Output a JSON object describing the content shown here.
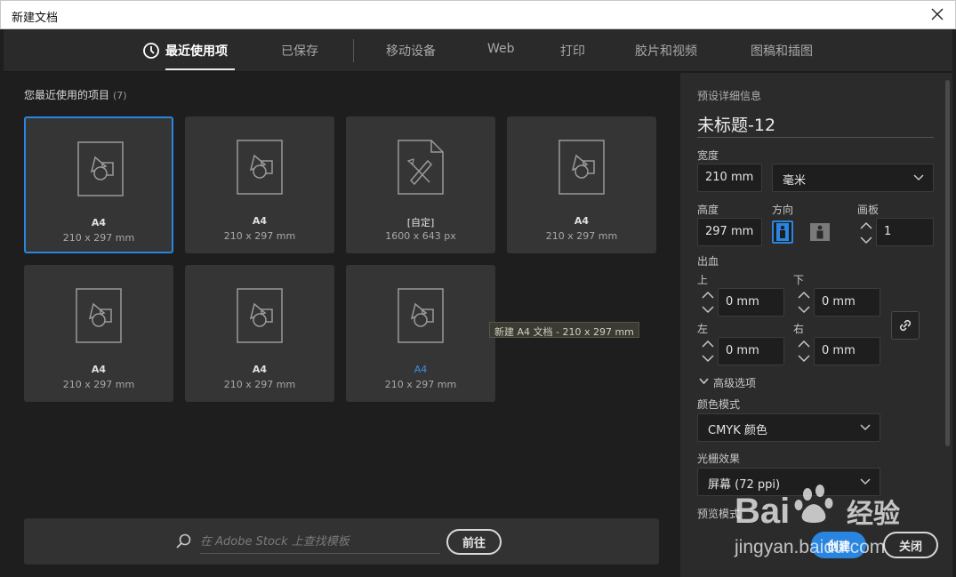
{
  "window": {
    "title": "新建文档"
  },
  "tabs": [
    {
      "label": "最近使用项",
      "active": true
    },
    {
      "label": "已保存"
    },
    {
      "label": "移动设备"
    },
    {
      "label": "Web"
    },
    {
      "label": "打印"
    },
    {
      "label": "胶片和视频"
    },
    {
      "label": "图稿和插图"
    }
  ],
  "recent": {
    "heading": "您最近使用的项目",
    "count": "(7)",
    "items": [
      {
        "name": "A4",
        "size": "210 x 297 mm",
        "selected": true
      },
      {
        "name": "A4",
        "size": "210 x 297 mm"
      },
      {
        "name": "[自定]",
        "size": "1600 x 643 px",
        "icon": "custom-document-icon"
      },
      {
        "name": "A4",
        "size": "210 x 297 mm"
      },
      {
        "name": "A4",
        "size": "210 x 297 mm"
      },
      {
        "name": "A4",
        "size": "210 x 297 mm"
      },
      {
        "name": "A4",
        "size": "210 x 297 mm",
        "hovered": true
      }
    ],
    "tooltip": "新建 A4 文档 - 210 x 297 mm"
  },
  "stock": {
    "placeholder": "在 Adobe Stock 上查找模板",
    "go_label": "前往"
  },
  "preset": {
    "heading": "预设详细信息",
    "doc_title": "未标题-12",
    "width_label": "宽度",
    "width_value": "210 mm",
    "unit_value": "毫米",
    "height_label": "高度",
    "height_value": "297 mm",
    "orientation_label": "方向",
    "orientation_selected": "portrait",
    "artboards_label": "画板",
    "artboards_value": "1",
    "bleed_label": "出血",
    "bleed_top_label": "上",
    "bleed_top_value": "0 mm",
    "bleed_bottom_label": "下",
    "bleed_bottom_value": "0 mm",
    "bleed_left_label": "左",
    "bleed_left_value": "0 mm",
    "bleed_right_label": "右",
    "bleed_right_value": "0 mm",
    "advanced_label": "高级选项",
    "color_mode_label": "颜色模式",
    "color_mode_value": "CMYK 颜色",
    "raster_label": "光栅效果",
    "raster_value": "屏幕 (72 ppi)",
    "preview_label": "预览模式"
  },
  "actions": {
    "create_label": "创建",
    "close_label": "关闭"
  },
  "colors": {
    "accent": "#2a85e0",
    "panel": "#2b2b2b",
    "card": "#353535"
  }
}
